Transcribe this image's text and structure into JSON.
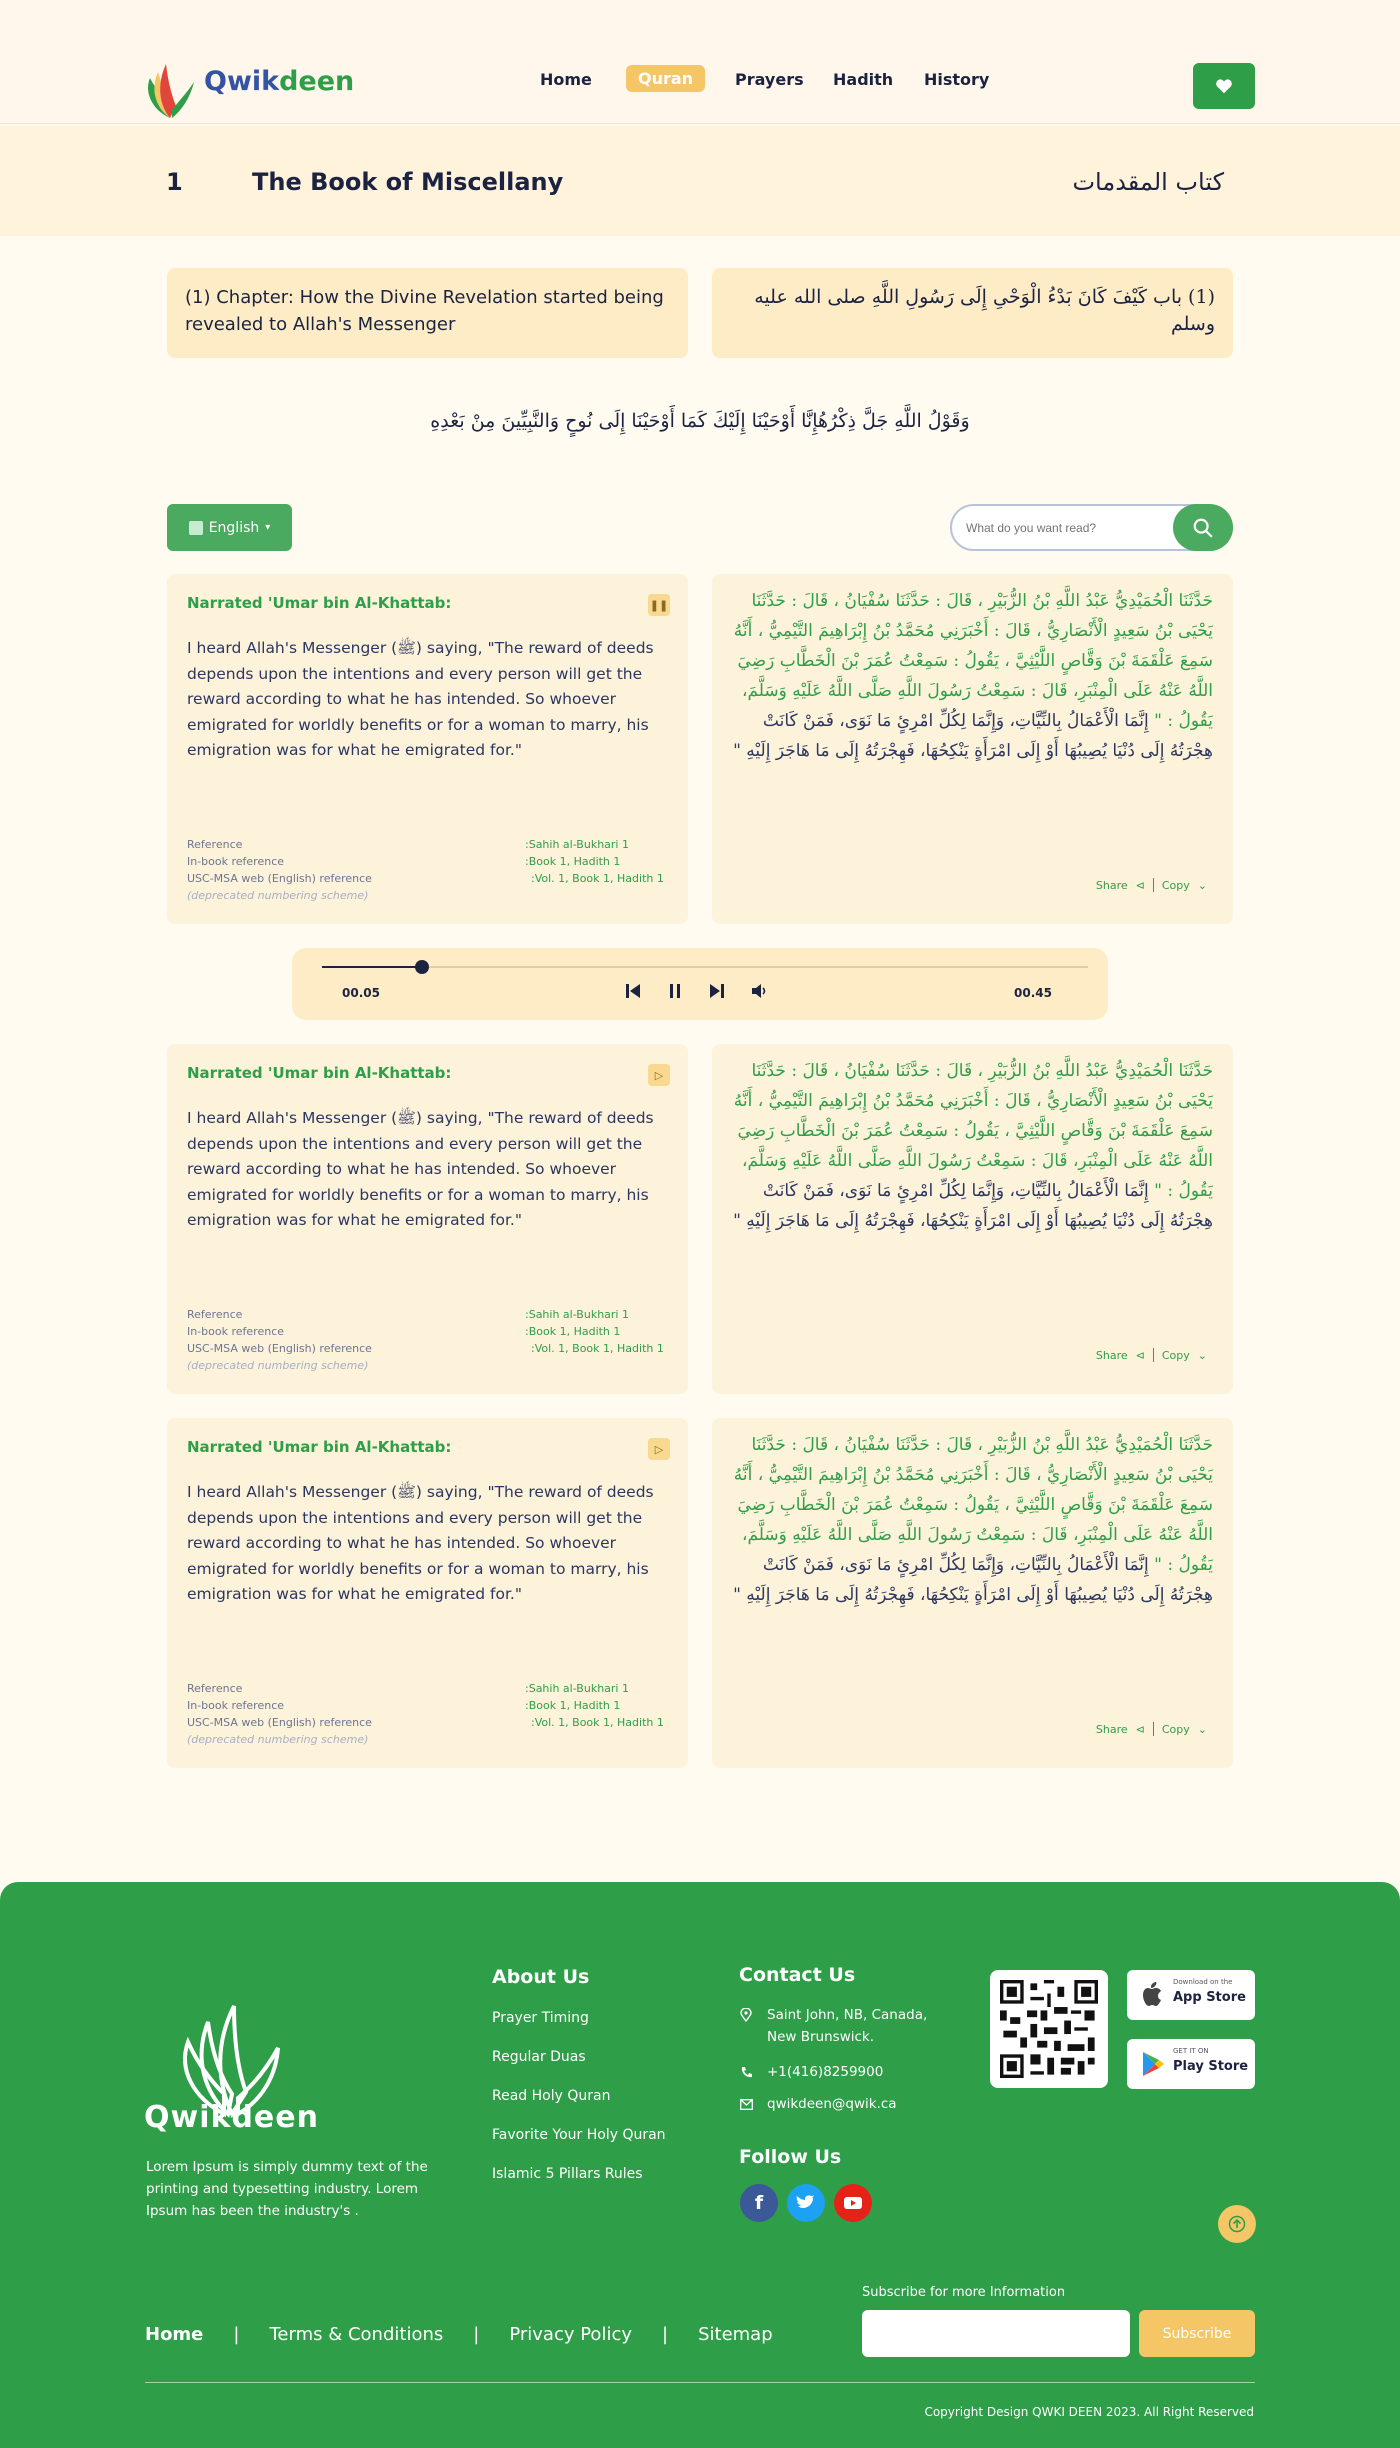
{
  "header": {
    "logo": {
      "part1": "Qwik",
      "part2": "deen"
    },
    "nav": [
      {
        "label": "Home",
        "active": false
      },
      {
        "label": "Quran",
        "active": true
      },
      {
        "label": "Prayers",
        "active": false
      },
      {
        "label": "Hadith",
        "active": false
      },
      {
        "label": "History",
        "active": false
      }
    ],
    "favorites_icon": "heart-icon"
  },
  "book": {
    "number": "1",
    "title": "The Book of Miscellany",
    "title_ar": "كتاب المقدمات"
  },
  "chapter": {
    "en": "(1) Chapter: How the Divine Revelation started being revealed to Allah's Messenger",
    "ar": "(1) باب كَيْفَ كَانَ بَدْءُ الْوَحْىِ إِلَى رَسُولِ اللَّهِ صلى الله عليه وسلم"
  },
  "verse": "وَقَوْلُ اللَّهِ جَلَّ ذِكْرُهُإِنَّا أَوْحَيْنَا إِلَيْكَ كَمَا أَوْحَيْنَا إِلَى نُوحٍ وَالنَّبِيِّينَ مِنْ بَعْدِهِ",
  "controls": {
    "language": "English",
    "search_placeholder": "What do you want read?"
  },
  "hadiths": [
    {
      "narrator": "Narrated 'Umar bin Al-Khattab:",
      "audio_state": "pause",
      "text_en": "I heard Allah's Messenger (ﷺ) saying, \"The reward of deeds depends upon the intentions and every person will get the reward according to what he has intended. So whoever emigrated for worldly benefits or for a woman to marry, his emigration was for what he emigrated for.\"",
      "ar_green": "حَدَّثَنَا الْحُمَيْدِيُّ عَبْدُ اللَّهِ بْنُ الزُّبَيْرِ ، قَالَ : حَدَّثَنَا سُفْيَانُ ، قَالَ : حَدَّثَنَا يَحْيَى بْنُ سَعِيدٍ الْأَنْصَارِيُّ ، قَالَ : أَخْبَرَنِي مُحَمَّدُ بْنُ إِبْرَاهِيمَ التَّيْمِيُّ ، أَنَّهُ سَمِعَ عَلْقَمَةَ بْنَ وَقَّاصٍ اللَّيْثِيَّ ، يَقُولُ : سَمِعْتُ عُمَرَ بْنَ الْخَطَّابِ رَضِيَ اللَّهُ عَنْهُ عَلَى الْمِنْبَرِ، قَالَ : سَمِعْتُ رَسُولَ اللَّهِ صَلَّى اللَّهُ عَلَيْهِ وَسَلَّمَ، يَقُولُ : \"",
      "ar_blue": "إِنَّمَا الْأَعْمَالُ بِالنِّيَّاتِ، وَإِنَّمَا لِكُلِّ امْرِئٍ مَا نَوَى، فَمَنْ كَانَتْ هِجْرَتُهُ إِلَى دُنْيَا يُصِيبُهَا أَوْ إِلَى امْرَأَةٍ يَنْكِحُهَا، فَهِجْرَتُهُ إِلَى مَا هَاجَرَ إِلَيْهِ \"",
      "refs": {
        "labels": [
          "Reference",
          "In-book reference",
          "USC-MSA web (English) reference",
          "(deprecated numbering scheme)"
        ],
        "values": [
          ":Sahih al-Bukhari 1",
          ":Book 1, Hadith 1",
          ":Vol. 1, Book 1, Hadith 1"
        ]
      },
      "share": "Share",
      "copy": "Copy"
    },
    {
      "narrator": "Narrated 'Umar bin Al-Khattab:",
      "audio_state": "speaker",
      "text_en": "I heard Allah's Messenger (ﷺ) saying, \"The reward of deeds depends upon the intentions and every person will get the reward according to what he has intended. So whoever emigrated for worldly benefits or for a woman to marry, his emigration was for what he emigrated for.\"",
      "ar_green": "حَدَّثَنَا الْحُمَيْدِيُّ عَبْدُ اللَّهِ بْنُ الزُّبَيْرِ ، قَالَ : حَدَّثَنَا سُفْيَانُ ، قَالَ : حَدَّثَنَا يَحْيَى بْنُ سَعِيدٍ الْأَنْصَارِيُّ ، قَالَ : أَخْبَرَنِي مُحَمَّدُ بْنُ إِبْرَاهِيمَ التَّيْمِيُّ ، أَنَّهُ سَمِعَ عَلْقَمَةَ بْنَ وَقَّاصٍ اللَّيْثِيَّ ، يَقُولُ : سَمِعْتُ عُمَرَ بْنَ الْخَطَّابِ رَضِيَ اللَّهُ عَنْهُ عَلَى الْمِنْبَرِ، قَالَ : سَمِعْتُ رَسُولَ اللَّهِ صَلَّى اللَّهُ عَلَيْهِ وَسَلَّمَ، يَقُولُ : \"",
      "ar_blue": "إِنَّمَا الْأَعْمَالُ بِالنِّيَّاتِ، وَإِنَّمَا لِكُلِّ امْرِئٍ مَا نَوَى، فَمَنْ كَانَتْ هِجْرَتُهُ إِلَى دُنْيَا يُصِيبُهَا أَوْ إِلَى امْرَأَةٍ يَنْكِحُهَا، فَهِجْرَتُهُ إِلَى مَا هَاجَرَ إِلَيْهِ \"",
      "refs": {
        "labels": [
          "Reference",
          "In-book reference",
          "USC-MSA web (English) reference",
          "(deprecated numbering scheme)"
        ],
        "values": [
          ":Sahih al-Bukhari 1",
          ":Book 1, Hadith 1",
          ":Vol. 1, Book 1, Hadith 1"
        ]
      },
      "share": "Share",
      "copy": "Copy"
    },
    {
      "narrator": "Narrated 'Umar bin Al-Khattab:",
      "audio_state": "speaker",
      "text_en": "I heard Allah's Messenger (ﷺ) saying, \"The reward of deeds depends upon the intentions and every person will get the reward according to what he has intended. So whoever emigrated for worldly benefits or for a woman to marry, his emigration was for what he emigrated for.\"",
      "ar_green": "حَدَّثَنَا الْحُمَيْدِيُّ عَبْدُ اللَّهِ بْنُ الزُّبَيْرِ ، قَالَ : حَدَّثَنَا سُفْيَانُ ، قَالَ : حَدَّثَنَا يَحْيَى بْنُ سَعِيدٍ الْأَنْصَارِيُّ ، قَالَ : أَخْبَرَنِي مُحَمَّدُ بْنُ إِبْرَاهِيمَ التَّيْمِيُّ ، أَنَّهُ سَمِعَ عَلْقَمَةَ بْنَ وَقَّاصٍ اللَّيْثِيَّ ، يَقُولُ : سَمِعْتُ عُمَرَ بْنَ الْخَطَّابِ رَضِيَ اللَّهُ عَنْهُ عَلَى الْمِنْبَرِ، قَالَ : سَمِعْتُ رَسُولَ اللَّهِ صَلَّى اللَّهُ عَلَيْهِ وَسَلَّمَ، يَقُولُ : \"",
      "ar_blue": "إِنَّمَا الْأَعْمَالُ بِالنِّيَّاتِ، وَإِنَّمَا لِكُلِّ امْرِئٍ مَا نَوَى، فَمَنْ كَانَتْ هِجْرَتُهُ إِلَى دُنْيَا يُصِيبُهَا أَوْ إِلَى امْرَأَةٍ يَنْكِحُهَا، فَهِجْرَتُهُ إِلَى مَا هَاجَرَ إِلَيْهِ \"",
      "refs": {
        "labels": [
          "Reference",
          "In-book reference",
          "USC-MSA web (English) reference",
          "(deprecated numbering scheme)"
        ],
        "values": [
          ":Sahih al-Bukhari 1",
          ":Book 1, Hadith 1",
          ":Vol. 1, Book 1, Hadith 1"
        ]
      },
      "share": "Share",
      "copy": "Copy"
    }
  ],
  "player": {
    "elapsed": "00.05",
    "duration": "00.45",
    "progress": 0.13
  },
  "footer": {
    "logo_text": "Qwikdeen",
    "description": "Lorem Ipsum is simply dummy text of the printing and typesetting industry.  Lorem Ipsum has been the industry's .",
    "about": {
      "title": "About Us",
      "links": [
        "Prayer Timing",
        "Regular Duas",
        "Read Holy Quran",
        "Favorite Your Holy Quran",
        "Islamic 5 Pillars Rules"
      ]
    },
    "contact": {
      "title": "Contact Us",
      "address": "Saint John, NB, Canada, New Brunswick.",
      "phone": "+1(416)8259900",
      "email": "qwikdeen@qwik.ca"
    },
    "follow": {
      "title": "Follow Us",
      "networks": [
        "facebook-icon",
        "twitter-icon",
        "youtube-icon"
      ]
    },
    "stores": [
      {
        "small": "Download on the",
        "big": "App Store"
      },
      {
        "small": "GET IT ON",
        "big": "Play Store"
      }
    ],
    "subscribe": {
      "label": "Subscribe for more Information",
      "button": "Subscribe"
    },
    "bottom_links": [
      "Home",
      "Terms & Conditions",
      "Privacy Policy",
      "Sitemap"
    ],
    "copyright": "Copyright Design QWKI DEEN 2023.  All Right Reserved"
  },
  "colors": {
    "brand_green": "#2f9e49",
    "accent_yellow": "#f4c665",
    "navy": "#1c2340",
    "cream": "#fffbf1"
  }
}
